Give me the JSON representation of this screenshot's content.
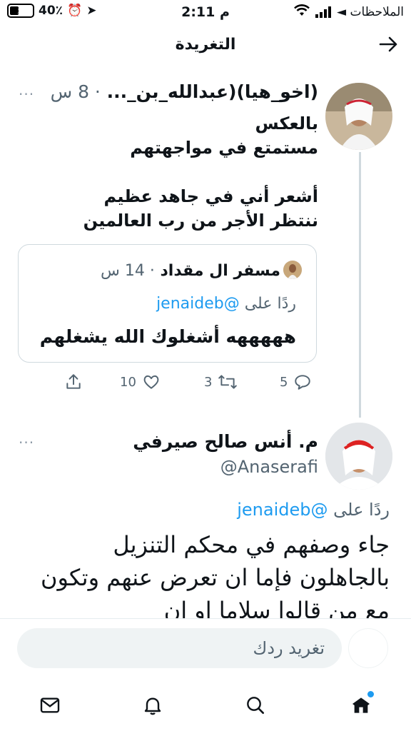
{
  "status_bar": {
    "back_app": "◄ الملاحظات",
    "time": "2:11 م",
    "battery": "40٪",
    "battery_level": 0.4
  },
  "header": {
    "title": "التغريدة"
  },
  "tweet1": {
    "name": "(اخو_هيا)(عبدالله_بن_...",
    "time": "· 8 س",
    "more": "···",
    "lines": [
      "بالعكس",
      "مستمتع في مواجهتهم",
      "أشعر أني في جاهد عظيم",
      "ننتظر الأجر من رب العالمين"
    ],
    "quote": {
      "name": "مسفر ال مقداد",
      "time": "· 14 س",
      "reply_prefix": "ردًا على",
      "reply_handle": "@jenaideb",
      "text": "هههههه أشغلوك الله يشغلهم"
    },
    "actions": {
      "replies": "5",
      "retweets": "3",
      "likes": "10"
    }
  },
  "tweet2": {
    "name": "م. أنس صالح صيرفي",
    "handle": "@Anaserafi",
    "more": "···",
    "reply_prefix": "ردًا على",
    "reply_handle": "@jenaideb",
    "text": "جاء وصفهم في محكم التنزيل بالجاهلون فإما ان تعرض عنهم وتكون مع من قالوا سلاما او ان"
  },
  "reply_box": {
    "placeholder": "تغريد ردك"
  },
  "nav": [
    "home-icon",
    "search-icon",
    "bell-icon",
    "mail-icon"
  ],
  "colors": {
    "accent": "#1d9bf0",
    "muted": "#536471",
    "line": "#cfd9de"
  }
}
